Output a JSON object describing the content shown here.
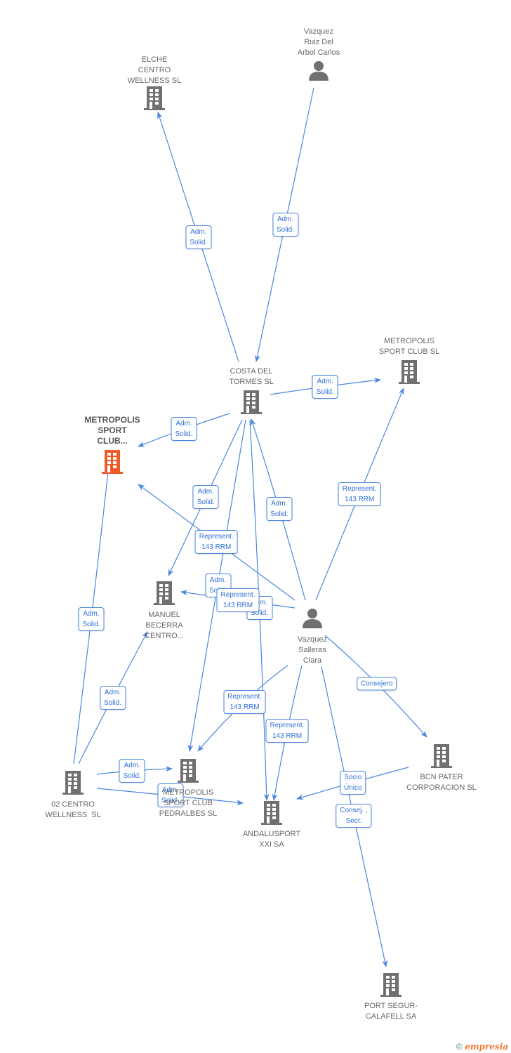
{
  "colors": {
    "edge": "#4a86e0",
    "node": "#707070",
    "main": "#f05a28"
  },
  "nodes": [
    {
      "id": "elche",
      "type": "company",
      "label": "ELCHE\nCENTRO\nWELLNESS SL"
    },
    {
      "id": "carlos",
      "type": "person",
      "label": "Vazquez\nRuiz Del\nArbol Carlos"
    },
    {
      "id": "costa",
      "type": "company",
      "label": "COSTA DEL\nTORMES SL"
    },
    {
      "id": "metrosl",
      "type": "company",
      "label": "METROPOLIS\nSPORT CLUB SL"
    },
    {
      "id": "main",
      "type": "company-main",
      "label": "METROPOLIS\nSPORT\nCLUB..."
    },
    {
      "id": "manuel",
      "type": "company",
      "label": "MANUEL\nBECERRA\nCENTRO..."
    },
    {
      "id": "clara",
      "type": "person",
      "label": "Vazquez\nSalleras\nClara"
    },
    {
      "id": "bcn",
      "type": "company",
      "label": "BCN PATER\nCORPORACION SL"
    },
    {
      "id": "o2",
      "type": "company",
      "label": "02 CENTRO\nWELLNESS  SL"
    },
    {
      "id": "pedralbes",
      "type": "company",
      "label": "METROPOLIS\nSPORT CLUB\nPEDRALBES SL"
    },
    {
      "id": "andalu",
      "type": "company",
      "label": "ANDALUSPORT\nXXI SA"
    },
    {
      "id": "port",
      "type": "company",
      "label": "PORT SEGUR-\nCALAFELL SA"
    }
  ],
  "edges": [
    {
      "from": "costa",
      "to": "elche",
      "label": "Adm.\nSolid."
    },
    {
      "from": "carlos",
      "to": "costa",
      "label": "Adm.\nSolid."
    },
    {
      "from": "costa",
      "to": "metrosl",
      "label": "Adm.\nSolid."
    },
    {
      "from": "costa",
      "to": "main",
      "label": "Adm.\nSolid."
    },
    {
      "from": "costa",
      "to": "manuel",
      "label": "Adm.\nSolid."
    },
    {
      "from": "clara",
      "to": "costa",
      "label": "Adm.\nSolid."
    },
    {
      "from": "clara",
      "to": "metrosl",
      "label": "Represent.\n143 RRM"
    },
    {
      "from": "clara",
      "to": "main",
      "label": "Represent.\n143 RRM"
    },
    {
      "from": "costa",
      "to": "pedralbes",
      "label": "Adm.\nSolid."
    },
    {
      "from": "costa",
      "to": "andalu",
      "label": "Adm.\nSolid."
    },
    {
      "from": "clara",
      "to": "manuel",
      "label": "Represent.\n143 RRM"
    },
    {
      "from": "clara",
      "to": "pedralbes",
      "label": "Represent.\n143 RRM"
    },
    {
      "from": "clara",
      "to": "andalu",
      "label": "Represent.\n143 RRM"
    },
    {
      "from": "clara",
      "to": "bcn",
      "label": "Consejero"
    },
    {
      "from": "bcn",
      "to": "andalu",
      "label": "Socio\nÚnico"
    },
    {
      "from": "clara",
      "to": "port",
      "label": "Consej. ,\nSecr."
    },
    {
      "from": "o2",
      "to": "main",
      "label": "Adm.\nSolid."
    },
    {
      "from": "o2",
      "to": "manuel",
      "label": "Adm.\nSolid."
    },
    {
      "from": "o2",
      "to": "pedralbes",
      "label": "Adm.\nSolid."
    },
    {
      "from": "o2",
      "to": "andalu",
      "label": "Adm.\nSolid."
    }
  ],
  "logo": {
    "copyright": "©",
    "brand": "empresia"
  }
}
